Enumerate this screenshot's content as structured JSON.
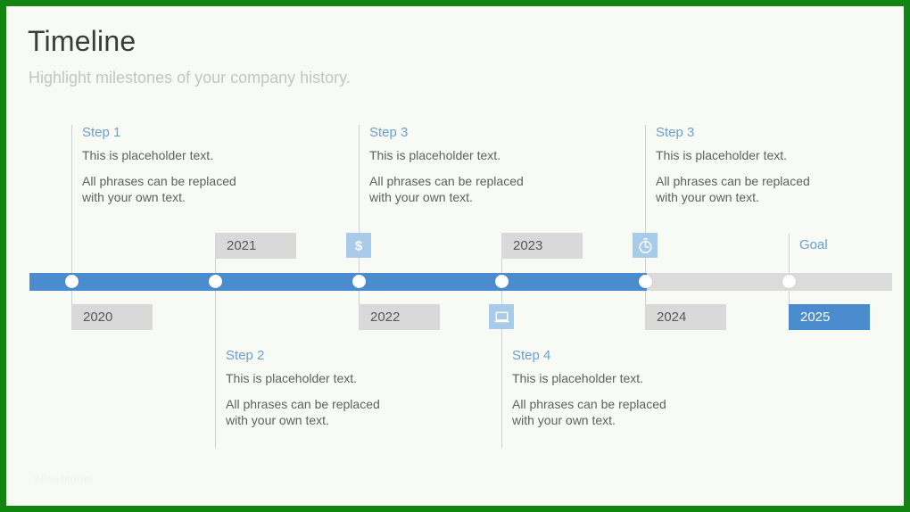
{
  "slide": {
    "title": "Timeline",
    "subtitle": "Highlight milestones of your company history.",
    "border_color": "#128412",
    "background_color": "#f7faf5",
    "watermark": "SlideModel"
  },
  "theme": {
    "accent_blue": "#4a8ccd",
    "icon_tile_blue": "#a8cbea",
    "rail_gray": "#dadbda",
    "year_box_gray": "#d9d9d9",
    "step_title_blue": "#6d9fd0",
    "body_text_gray": "#606060",
    "connector_gray": "#cfd3cf"
  },
  "rail": {
    "progress_percent": 72,
    "fill_color": "#4a8ccd",
    "track_color": "#dadbda",
    "node_count": 6
  },
  "years": [
    {
      "label": "2020",
      "position": "below",
      "style": "gray"
    },
    {
      "label": "2021",
      "position": "above",
      "style": "gray"
    },
    {
      "label": "2022",
      "position": "below",
      "style": "gray"
    },
    {
      "label": "2023",
      "position": "above",
      "style": "gray"
    },
    {
      "label": "2024",
      "position": "below",
      "style": "gray"
    },
    {
      "label": "2025",
      "position": "below",
      "style": "accent"
    }
  ],
  "icons": [
    {
      "name": "dollar-icon",
      "position": "above",
      "node": 3
    },
    {
      "name": "laptop-icon",
      "position": "below",
      "node": 4
    },
    {
      "name": "stopwatch-icon",
      "position": "above",
      "node": 5
    }
  ],
  "goal": {
    "label": "Goal"
  },
  "steps": [
    {
      "title": "Step 1",
      "line1": "This is placeholder  text.",
      "line2": "All phrases can be replaced",
      "line3": "with your own text.",
      "position": "above"
    },
    {
      "title": "Step 2",
      "line1": "This is placeholder  text.",
      "line2": "All phrases can be replaced",
      "line3": "with your own text.",
      "position": "below"
    },
    {
      "title": "Step 3",
      "line1": "This is placeholder  text.",
      "line2": "All phrases can be replaced",
      "line3": "with your own text.",
      "position": "above"
    },
    {
      "title": "Step 4",
      "line1": "This is placeholder  text.",
      "line2": "All phrases can be replaced",
      "line3": "with your own text.",
      "position": "below"
    },
    {
      "title": "Step 3",
      "line1": "This is placeholder  text.",
      "line2": "All phrases can be replaced",
      "line3": "with your own text.",
      "position": "above"
    }
  ]
}
